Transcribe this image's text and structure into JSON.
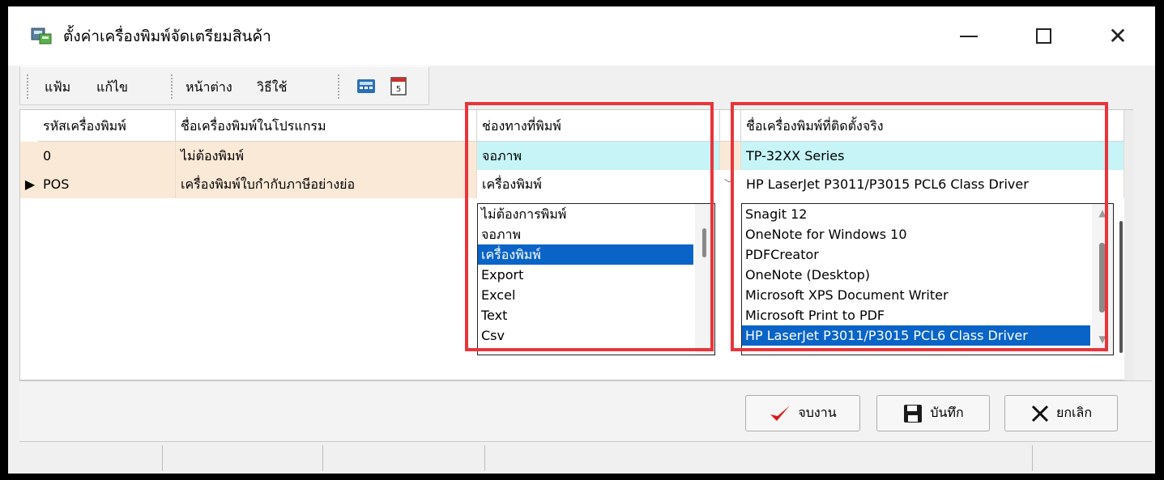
{
  "window": {
    "title": "ตั้งค่าเครื่องพิมพ์จัดเตรียมสินค้า",
    "icon": "printer-setup-icon"
  },
  "toolbar": {
    "file": "แฟ้ม",
    "edit": "แก้ไข",
    "window": "หน้าต่าง",
    "help": "วิธีใช้",
    "icons": [
      "calculator-icon",
      "calendar-icon"
    ]
  },
  "grid": {
    "headers": [
      "รหัสเครื่องพิมพ์",
      "ชื่อเครื่องพิมพ์ในโปรแกรม",
      "ช่องทางที่พิมพ์",
      "ชื่อเครื่องพิมพ์ที่ติดตั้งจริง"
    ],
    "rows": [
      {
        "code": "0",
        "name": "ไม่ต้องพิมพ์",
        "channel": "จอภาพ",
        "device": "TP-32XX Series"
      },
      {
        "indicator": "▶",
        "code": "POS",
        "name": "เครื่องพิมพ์ใบกำกับภาษีอย่างย่อ",
        "channel": "เครื่องพิมพ์",
        "device": "HP LaserJet P3011/P3015 PCL6 Class Driver"
      }
    ]
  },
  "channel_dropdown": {
    "items": [
      "ไม่ต้องการพิมพ์",
      "จอภาพ",
      "เครื่องพิมพ์",
      "Export",
      "Excel",
      "Text",
      "Csv"
    ],
    "selected": "เครื่องพิมพ์"
  },
  "device_dropdown": {
    "items": [
      "Snagit 12",
      "OneNote for Windows 10",
      "PDFCreator",
      "OneNote (Desktop)",
      "Microsoft XPS Document Writer",
      "Microsoft Print to PDF",
      "HP LaserJet P3011/P3015 PCL6 Class Driver"
    ],
    "selected": "HP LaserJet P3011/P3015 PCL6 Class Driver"
  },
  "buttons": {
    "finish": "จบงาน",
    "save": "บันทึก",
    "cancel": "ยกเลิก"
  },
  "colors": {
    "highlight": "#e8353c",
    "selection": "#0a64c8",
    "row_peach": "#fbe9d7",
    "cell_cyan": "#c6f4f7"
  }
}
